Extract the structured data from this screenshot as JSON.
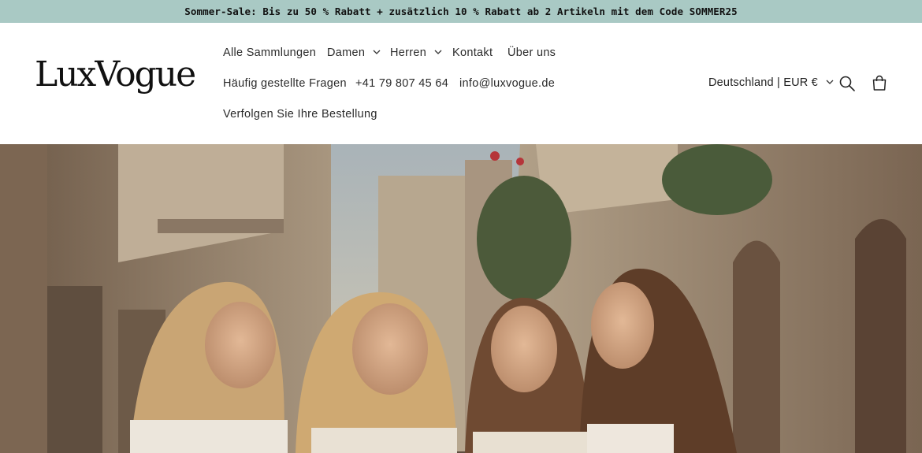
{
  "announcement": {
    "text": "Sommer-Sale: Bis zu 50 % Rabatt + zusätzlich 10 % Rabatt ab 2 Artikeln mit dem Code SOMMER25"
  },
  "header": {
    "logo": "LuxVogue",
    "nav": {
      "all_collections": "Alle Sammlungen",
      "women": "Damen",
      "men": "Herren",
      "contact": "Kontakt",
      "about": "Über uns",
      "faq": "Häufig gestellte Fragen",
      "phone": "+41 79 807 45 64",
      "email": "info@luxvogue.de",
      "track_order": "Verfolgen Sie Ihre Bestellung"
    },
    "locale": "Deutschland | EUR €",
    "icons": {
      "search": "search-icon",
      "cart": "cart-icon",
      "chevron": "chevron-down-icon"
    }
  },
  "colors": {
    "announcement_bg": "#a9c9c4",
    "text": "#1f1f1f"
  },
  "hero": {
    "image": "photo of four laughing women in a narrow sunlit old-town street"
  }
}
